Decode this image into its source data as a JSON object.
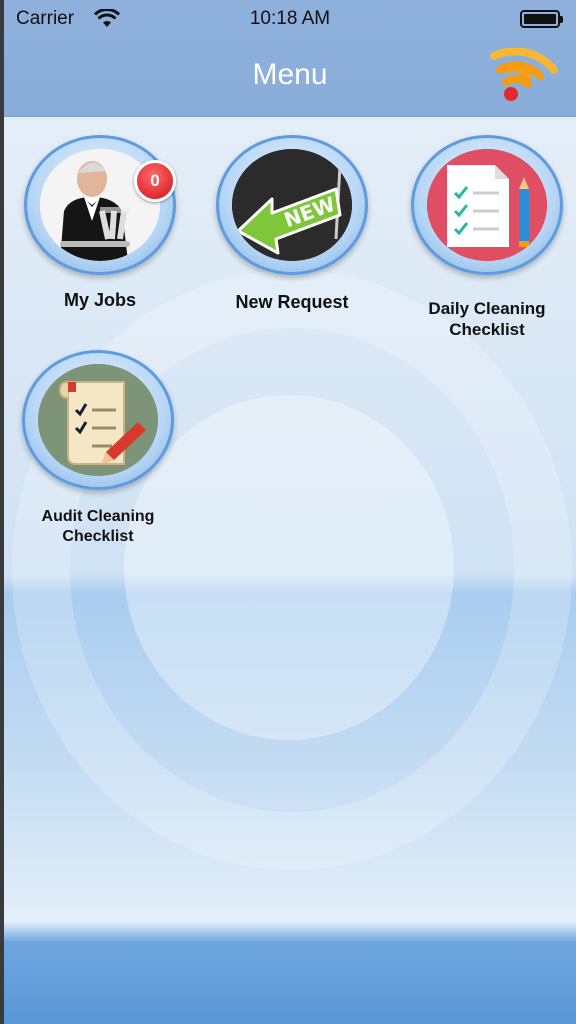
{
  "status_bar": {
    "carrier": "Carrier",
    "time": "10:18 AM"
  },
  "nav": {
    "title": "Menu"
  },
  "menu_items": [
    {
      "label": "My Jobs",
      "badge": "0",
      "icon": "waiter-icon"
    },
    {
      "label": "New Request",
      "icon": "new-arrow-icon"
    },
    {
      "label": "Daily Cleaning Checklist",
      "icon": "checklist-pencil-icon"
    },
    {
      "label": "Audit Cleaning Checklist",
      "icon": "audit-checklist-icon"
    }
  ],
  "colors": {
    "nav_bar": "#8fb1dc",
    "badge": "#d0101a",
    "rss_orange": "#f39c12",
    "rss_red": "#e32a2a"
  }
}
